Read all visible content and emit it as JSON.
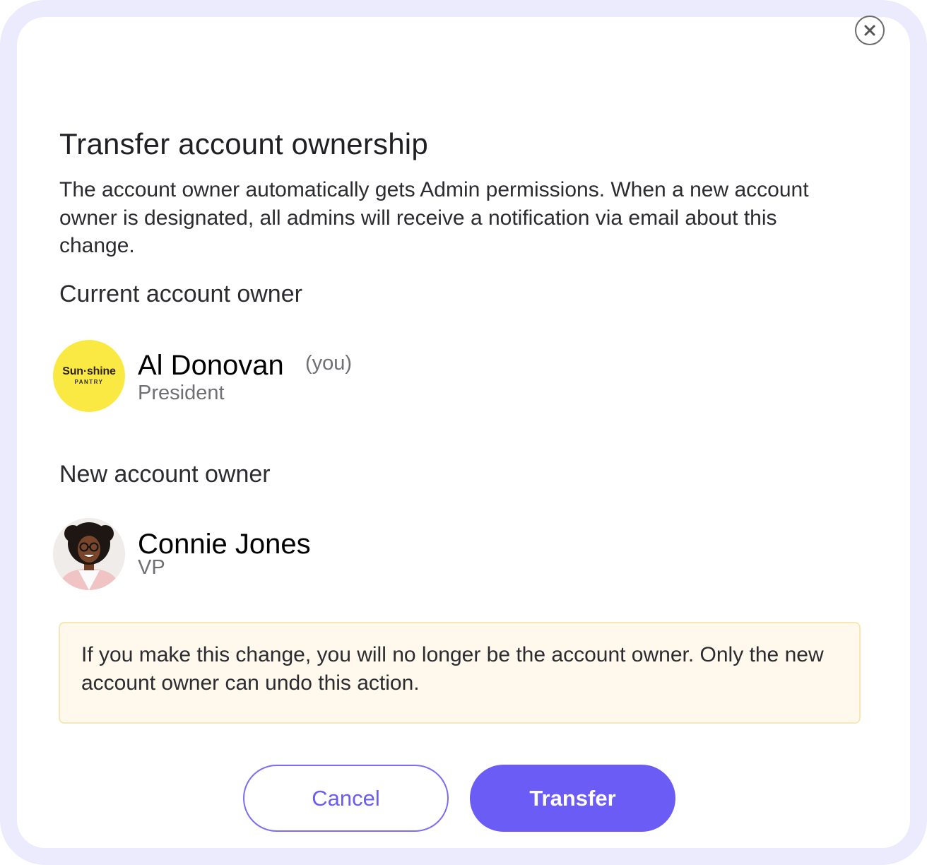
{
  "modal": {
    "title": "Transfer account ownership",
    "description": "The account owner automatically gets Admin permissions. When a new account owner is designated, all admins will receive a notification via email about this change.",
    "close_icon": "close-icon"
  },
  "current_owner": {
    "section_label": "Current account owner",
    "name": "Al Donovan",
    "you_tag": "(you)",
    "role": "President",
    "logo": {
      "main": "Sun·shine",
      "sub": "PANTRY",
      "background": "#fbe943"
    }
  },
  "new_owner": {
    "section_label": "New account owner",
    "name": "Connie Jones",
    "role": "VP"
  },
  "warning": {
    "text": "If you make this change, you will no longer be the account owner. Only the new account owner can undo this action."
  },
  "actions": {
    "cancel_label": "Cancel",
    "transfer_label": "Transfer"
  },
  "colors": {
    "accent": "#6b5cf6",
    "frame": "#ecebfd",
    "warning_bg": "#fef9ec",
    "warning_border": "#f6e7b6"
  }
}
